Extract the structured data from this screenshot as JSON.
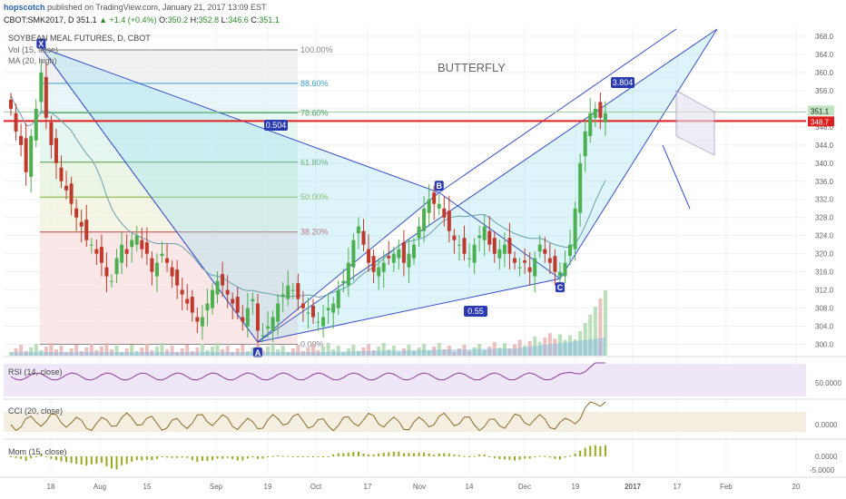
{
  "header": {
    "publisher": "hopscotch",
    "published_text": "published on TradingView.com, January 21, 2017 13:09 EST",
    "symbol_line": "CBOT:SMK2017, D",
    "close_last": "351.1",
    "change": "▲ +1.4 (+0.4%)",
    "open": "O:",
    "open_v": "350.2",
    "high": "H:",
    "high_v": "352.8",
    "low": "L:",
    "low_v": "346.6",
    "close": "C:",
    "close_v": "351.1"
  },
  "legend": {
    "title": "SOYBEAN MEAL FUTURES, D, CBOT",
    "vol": "Vol (15, false)",
    "ma": "MA (20, high)"
  },
  "annotations": {
    "pattern": "BUTTERFLY",
    "points": [
      "X",
      "A",
      "B",
      "C"
    ],
    "ratios": [
      "0.504",
      "3.804",
      "0.55"
    ]
  },
  "price_tags": {
    "last": "351.1",
    "line": "348.7"
  },
  "panes": {
    "rsi": "RSI (14, close)",
    "cci": "CCI (20, close)",
    "mom": "Mom (15, close)",
    "rsi_ticks": [
      "50.0000"
    ],
    "cci_ticks": [
      "0.0000"
    ],
    "mom_ticks": [
      "0.0000",
      "-5.0000"
    ]
  },
  "colors": {
    "up": "#4caf50",
    "down": "#c0392b",
    "pattern_line": "#3a4fc8",
    "price_line": "#e02020",
    "rsi": "#8e3b9a",
    "cci": "#8b6a2c",
    "mom": "#9aa820"
  },
  "chart_data": {
    "type": "candlestick",
    "title": "SOYBEAN MEAL FUTURES, D, CBOT",
    "x_tick_labels": [
      "18",
      "Aug",
      "15",
      "Sep",
      "19",
      "Oct",
      "17",
      "Nov",
      "14",
      "Dec",
      "19",
      "2017",
      "17",
      "Feb",
      "20"
    ],
    "y_tick_labels": [
      "368.0",
      "364.0",
      "360.0",
      "356.0",
      "352.0",
      "348.0",
      "344.0",
      "340.0",
      "336.0",
      "332.0",
      "328.0",
      "324.0",
      "320.0",
      "316.0",
      "312.0",
      "308.0",
      "304.0",
      "300.0"
    ],
    "ylim": [
      297.5,
      370
    ],
    "fib_levels": [
      {
        "label": "100.00%",
        "price": 365.0
      },
      {
        "label": "88.60%",
        "price": 357.6
      },
      {
        "label": "78.60%",
        "price": 351.1
      },
      {
        "label": "61.80%",
        "price": 340.2
      },
      {
        "label": "50.00%",
        "price": 332.5
      },
      {
        "label": "38.20%",
        "price": 324.8
      },
      {
        "label": "0.00%",
        "price": 300.0
      }
    ],
    "pattern_points": {
      "X": {
        "bar": 6,
        "price": 365.5
      },
      "A": {
        "bar": 49,
        "price": 300.5
      },
      "B": {
        "bar": 85,
        "price": 333.5
      },
      "C": {
        "bar": 109,
        "price": 314.5
      }
    },
    "closes": [
      352,
      347,
      344,
      338,
      346,
      352,
      360,
      350,
      344,
      340,
      336,
      334,
      331,
      328,
      326,
      323,
      322,
      320,
      318,
      315,
      314,
      319,
      322,
      320,
      323,
      324,
      321,
      320,
      316,
      318,
      320,
      318,
      315,
      313,
      311,
      309,
      307,
      305,
      306,
      309,
      312,
      314,
      313,
      311,
      309,
      307,
      305,
      308,
      310,
      303,
      302,
      304,
      306,
      309,
      311,
      313,
      312,
      310,
      308,
      307,
      306,
      305,
      306,
      308,
      309,
      312,
      314,
      318,
      323,
      326,
      322,
      318,
      316,
      317,
      318,
      319,
      320,
      321,
      318,
      320,
      322,
      326,
      330,
      332,
      331,
      331,
      328,
      325,
      323,
      322,
      320,
      319,
      322,
      324,
      326,
      322,
      320,
      321,
      322,
      320,
      318,
      317,
      318,
      316,
      319,
      322,
      320,
      318,
      316,
      316,
      318,
      322,
      330,
      340,
      347,
      351,
      352,
      350,
      351
    ],
    "rsi": {
      "ticks": [
        50
      ]
    },
    "cci": {
      "ticks": [
        0
      ]
    },
    "mom": {
      "ticks": [
        0,
        -5
      ]
    }
  }
}
